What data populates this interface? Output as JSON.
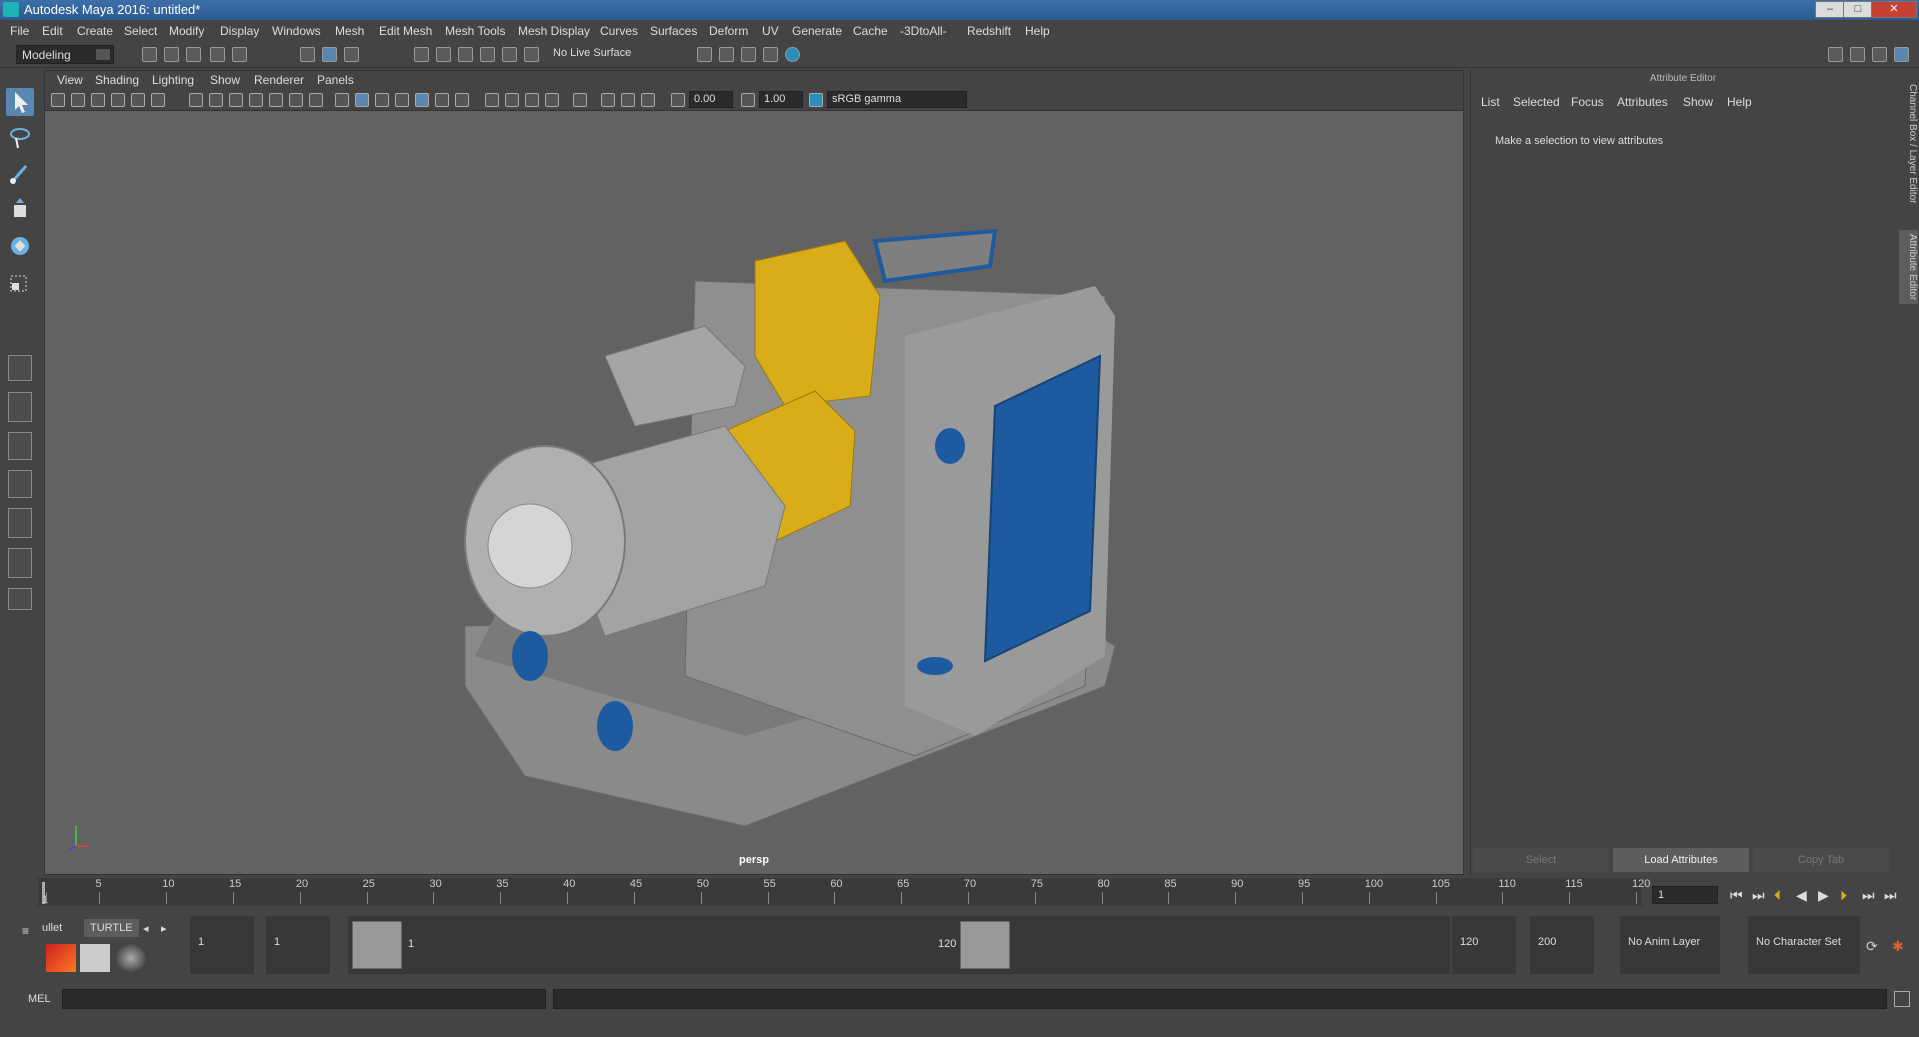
{
  "window": {
    "title": "Autodesk Maya 2016: untitled*",
    "minimize": "–",
    "maximize": "□",
    "close": "✕"
  },
  "menubar": [
    "File",
    "Edit",
    "Create",
    "Select",
    "Modify",
    "Display",
    "Windows",
    "Mesh",
    "Edit Mesh",
    "Mesh Tools",
    "Mesh Display",
    "Curves",
    "Surfaces",
    "Deform",
    "UV",
    "Generate",
    "Cache",
    "-3DtoAll-",
    "Redshift",
    "Help"
  ],
  "shelf": {
    "mode": "Modeling",
    "live_surface": "No Live Surface"
  },
  "viewport": {
    "menu": [
      "View",
      "Shading",
      "Lighting",
      "Show",
      "Renderer",
      "Panels"
    ],
    "near_value": "0.00",
    "far_value": "1.00",
    "color_space": "sRGB gamma",
    "camera_label": "persp",
    "colors": {
      "gray_metal": "#9a9a9a",
      "yellow_guard": "#d9ac1a",
      "blue_door": "#1e5aa0"
    }
  },
  "attribute_editor": {
    "title": "Attribute Editor",
    "menu": [
      "List",
      "Selected",
      "Focus",
      "Attributes",
      "Show",
      "Help"
    ],
    "message": "Make a selection to view attributes",
    "buttons": {
      "select": "Select",
      "load": "Load Attributes",
      "copy": "Copy Tab"
    }
  },
  "side_tabs": {
    "channel_box": "Channel Box / Layer Editor",
    "attribute_editor": "Attribute Editor"
  },
  "timeline": {
    "ticks": [
      "1",
      "5",
      "10",
      "15",
      "20",
      "25",
      "30",
      "35",
      "40",
      "45",
      "50",
      "55",
      "60",
      "65",
      "70",
      "75",
      "80",
      "85",
      "90",
      "95",
      "100",
      "105",
      "110",
      "115",
      "120"
    ],
    "current_frame": "1"
  },
  "range": {
    "shelf_tabs": {
      "bullet": "ullet",
      "turtle": "TURTLE"
    },
    "start_frame": "1",
    "playback_start": "1",
    "range_start_label": "1",
    "range_end_label": "120",
    "playback_end": "120",
    "end_frame": "200",
    "anim_layer": "No Anim Layer",
    "character_set": "No Character Set"
  },
  "command_line": {
    "language": "MEL"
  }
}
